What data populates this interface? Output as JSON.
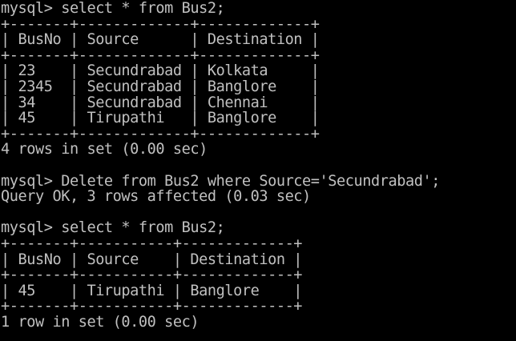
{
  "terminal": {
    "fg_color": "#c0c0c0",
    "bg_color": "#000000",
    "lines": [
      "mysql> select * from Bus2;",
      "+-------+-------------+-------------+",
      "| BusNo | Source      | Destination |",
      "+-------+-------------+-------------+",
      "| 23    | Secundrabad | Kolkata     |",
      "| 2345  | Secundrabad | Banglore    |",
      "| 34    | Secundrabad | Chennai     |",
      "| 45    | Tirupathi   | Banglore    |",
      "+-------+-------------+-------------+",
      "4 rows in set (0.00 sec)",
      "",
      "mysql> Delete from Bus2 where Source='Secundrabad';",
      "Query OK, 3 rows affected (0.03 sec)",
      "",
      "mysql> select * from Bus2;",
      "+-------+-----------+-------------+",
      "| BusNo | Source    | Destination |",
      "+-------+-----------+-------------+",
      "| 45    | Tirupathi | Banglore    |",
      "+-------+-----------+-------------+",
      "1 row in set (0.00 sec)"
    ]
  }
}
